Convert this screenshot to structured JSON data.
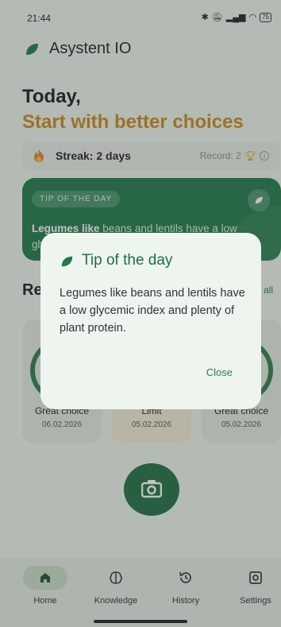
{
  "status": {
    "time": "21:44",
    "battery": "75"
  },
  "app": {
    "title": "Asystent IO"
  },
  "header": {
    "today": "Today,",
    "subtitle": "Start with better choices"
  },
  "streak": {
    "label": "Streak: 2 days",
    "record": "Record: 2"
  },
  "tip_card": {
    "badge": "TIP OF THE DAY",
    "text_bold": "Legumes like",
    "text_rest": " beans and lentils have a low glycemic index and plenty of plant protein."
  },
  "recent": {
    "title": "Recent",
    "see_all": "all",
    "cards": [
      {
        "label": "Great choice",
        "date": "06.02.2026"
      },
      {
        "label": "Limit",
        "date": "05.02.2026"
      },
      {
        "label": "Great choice",
        "date": "05.02.2026"
      }
    ]
  },
  "nav": [
    {
      "label": "Home"
    },
    {
      "label": "Knowledge"
    },
    {
      "label": "History"
    },
    {
      "label": "Settings"
    }
  ],
  "dialog": {
    "title": "Tip of the day",
    "body": "Legumes like beans and lentils have a low glycemic index and plenty of plant protein.",
    "close": "Close"
  },
  "colors": {
    "primary": "#1f7a4b",
    "accent": "#c98a1c",
    "limit_card": "#f4ecd6"
  }
}
